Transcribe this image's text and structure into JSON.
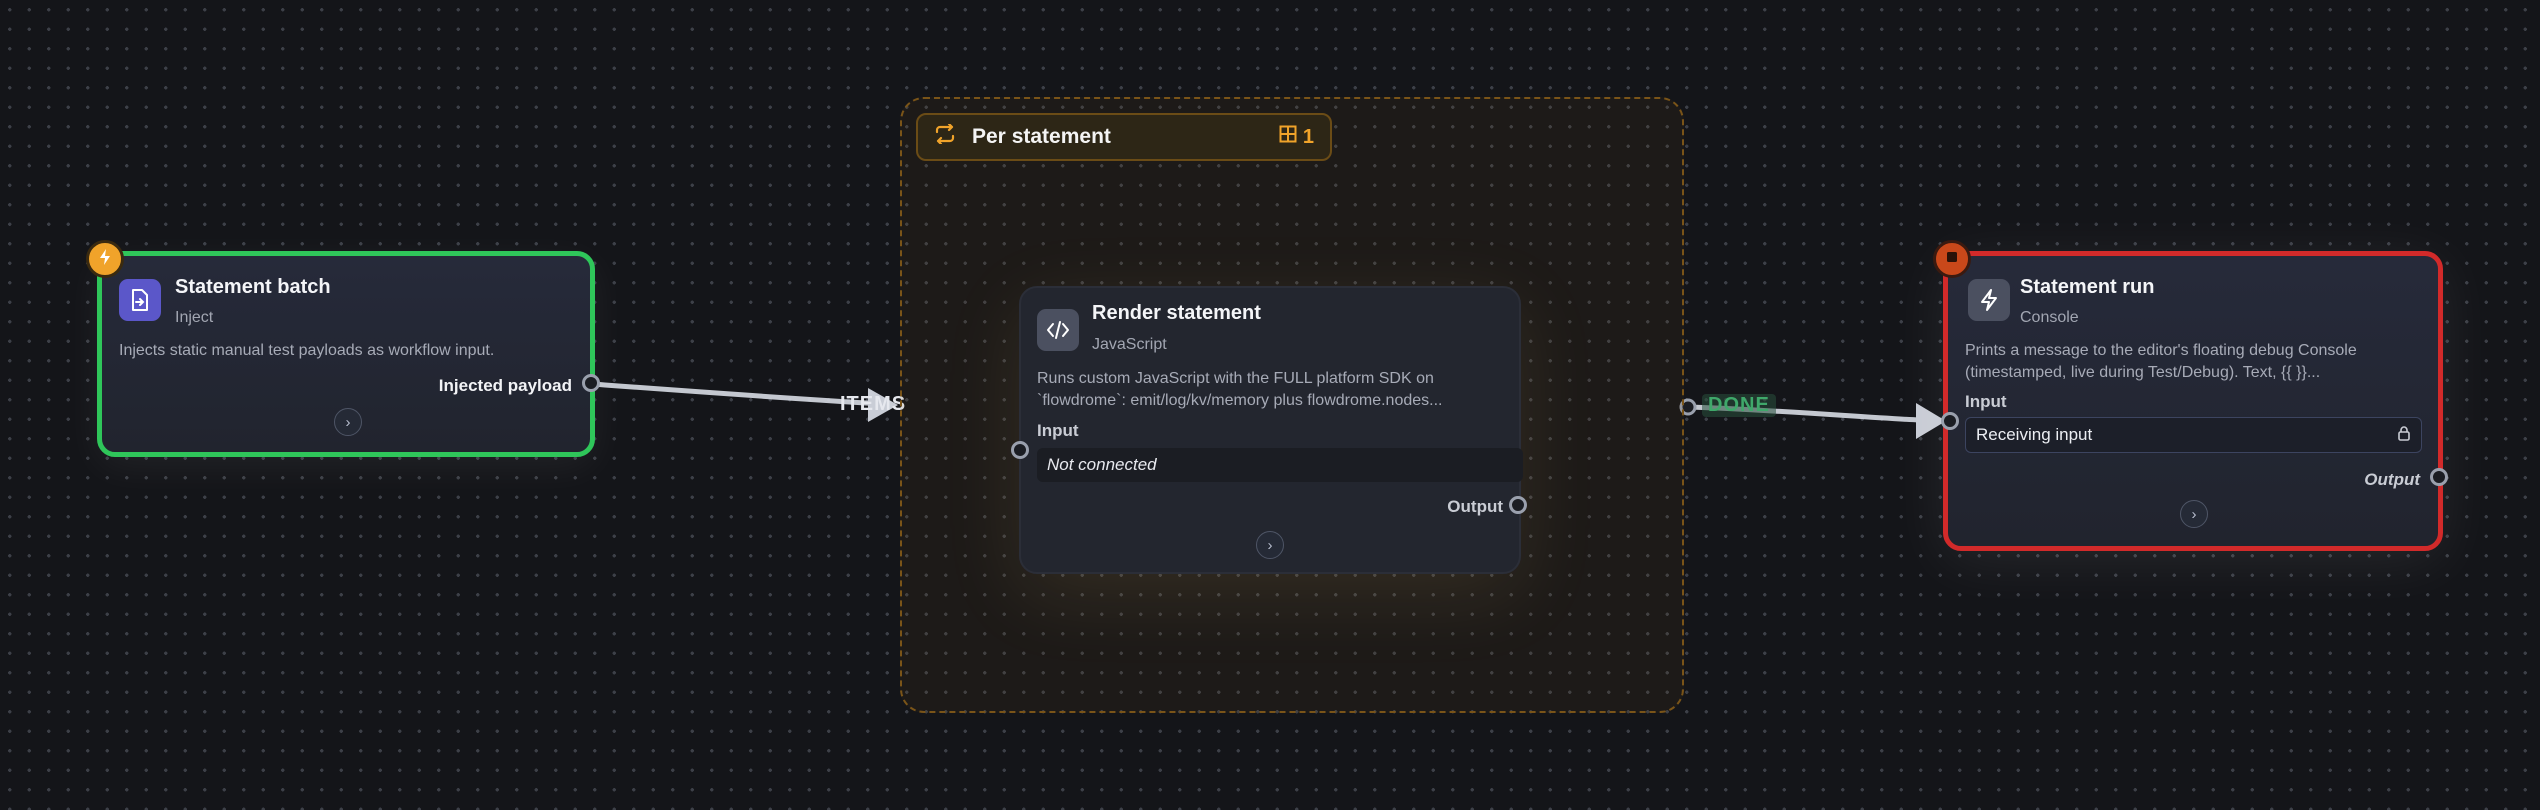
{
  "loop": {
    "title": "Per statement",
    "count": "1",
    "icon": "repeat-icon"
  },
  "nodes": {
    "batch": {
      "title": "Statement batch",
      "subtitle": "Inject",
      "description": "Injects static manual test payloads as workflow input.",
      "output_label": "Injected payload",
      "icon": "file-import-icon",
      "accent": "#2fc65a"
    },
    "render": {
      "title": "Render statement",
      "subtitle": "JavaScript",
      "description_line1": "Runs custom JavaScript with the FULL platform SDK on",
      "description_line2": "`flowdrome`: emit/log/kv/memory plus flowdrome.nodes...",
      "input_label": "Input",
      "input_value": "Not connected",
      "output_label": "Output",
      "icon": "code-icon"
    },
    "console": {
      "title": "Statement run",
      "subtitle": "Console",
      "description_line1": "Prints a message to the editor's floating debug Console",
      "description_line2": "(timestamped, live during Test/Debug). Text, {{ }}...",
      "input_label": "Input",
      "input_value": "Receiving input",
      "output_label": "Output",
      "icon": "bolt-icon",
      "accent": "#d22a2a"
    }
  },
  "edges": {
    "items_label": "ITEMS",
    "done_label": "DONE"
  },
  "colors": {
    "green": "#2fc65a",
    "red": "#d22a2a",
    "orange": "#f0a32a",
    "done_green": "#3fa86a"
  }
}
